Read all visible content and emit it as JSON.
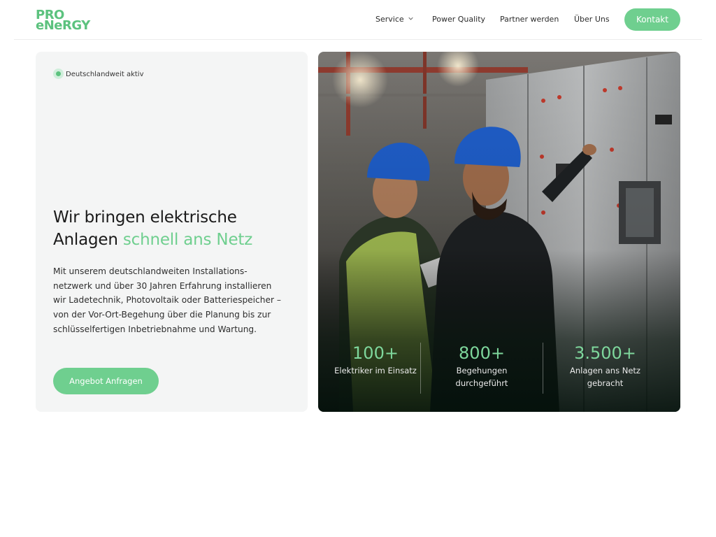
{
  "header": {
    "logo": {
      "line1": "PRO",
      "line2": "eNeRGY"
    },
    "nav": [
      {
        "label": "Service",
        "has_dropdown": true
      },
      {
        "label": "Power Quality"
      },
      {
        "label": "Partner werden"
      },
      {
        "label": "Über Uns"
      }
    ],
    "cta_label": "Kontakt"
  },
  "hero": {
    "badge": "Deutschlandweit aktiv",
    "headline_part1": "Wir bringen elektrische Anlagen ",
    "headline_accent": "schnell ans Netz",
    "intro": "Mit unserem deutschlandweiten Installations-netzwerk und über 30 Jahren Erfahrung installieren wir Ladetechnik, Photovoltaik oder Batteriespeicher – von der Vor-Ort-Begehung über die Planung bis zur schlüsselfertigen Inbetriebnahme und Wartung.",
    "cta_label": "Angebot Anfragen"
  },
  "stats": [
    {
      "value": "100+",
      "label": "Elektriker im Einsatz"
    },
    {
      "value": "800+",
      "label": "Begehungen durchgeführt"
    },
    {
      "value": "3.500+",
      "label": "Anlagen ans Netz gebracht"
    }
  ],
  "colors": {
    "accent": "#6fcf8f",
    "logo": "#5cc27e",
    "card_bg": "#f4f5f5"
  }
}
